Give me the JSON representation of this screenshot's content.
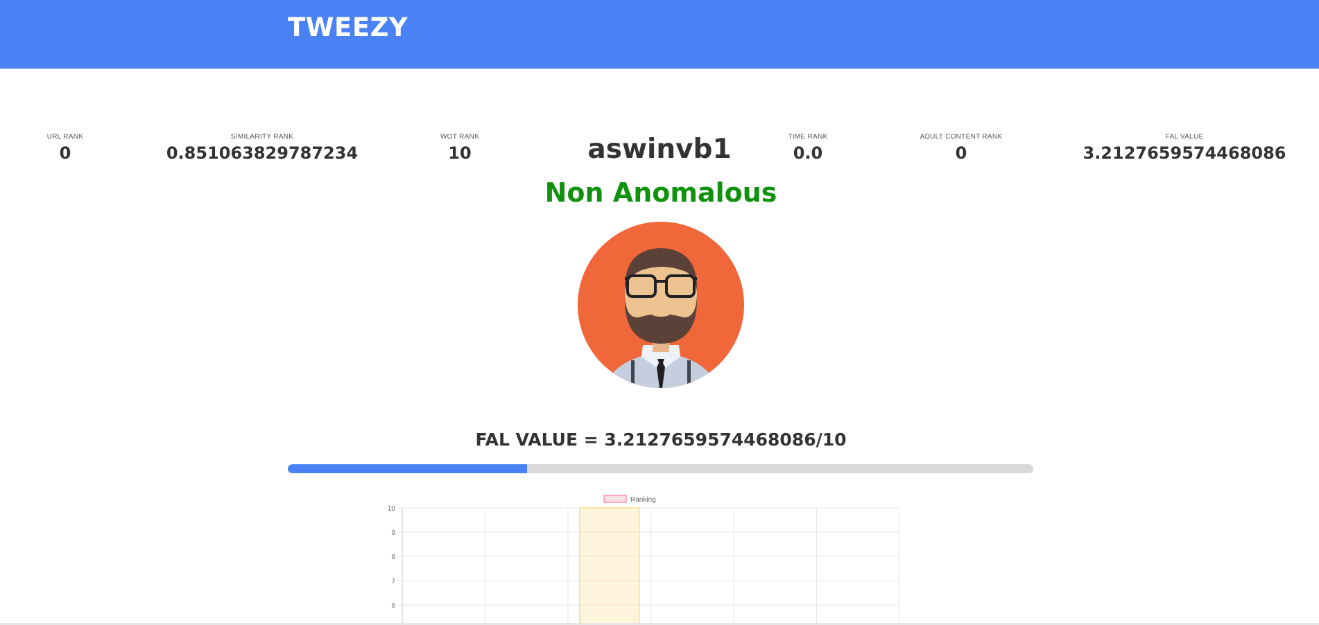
{
  "header": {
    "brand": "TWEEZY"
  },
  "stats": [
    {
      "label": "URL RANK",
      "value": "0"
    },
    {
      "label": "SIMILARITY RANK",
      "value": "0.851063829787234"
    },
    {
      "label": "WOT RANK",
      "value": "10"
    },
    {
      "label": "TIME RANK",
      "value": "0.0"
    },
    {
      "label": "ADULT CONTENT RANK",
      "value": "0"
    },
    {
      "label": "FAL VALUE",
      "value": "3.2127659574468086"
    }
  ],
  "profile": {
    "username": "aswinvb1",
    "verdict": "Non Anomalous",
    "verdict_color": "#11920f"
  },
  "fal": {
    "heading": "FAL VALUE = 3.2127659574468086/10",
    "value": 3.2127659574468086,
    "max": 10
  },
  "colors": {
    "accent": "#4a81f4",
    "avatar_background": "#f0673a"
  },
  "chart_data": {
    "type": "bar",
    "legend": [
      "Ranking"
    ],
    "legend_placement": "top-center",
    "grid": true,
    "ylim": [
      5.5,
      10
    ],
    "yticks": [
      6,
      7,
      8,
      9,
      10
    ],
    "categories": [
      "",
      "",
      "",
      "",
      "",
      ""
    ],
    "series": [
      {
        "name": "Ranking",
        "values": [
          0,
          0,
          10,
          0,
          0,
          0
        ],
        "bar_colors": [
          "#ff6384",
          "#36a2eb",
          "#ffce56",
          "#4bc0c0",
          "#9966ff",
          "#ff9f40"
        ]
      }
    ]
  }
}
